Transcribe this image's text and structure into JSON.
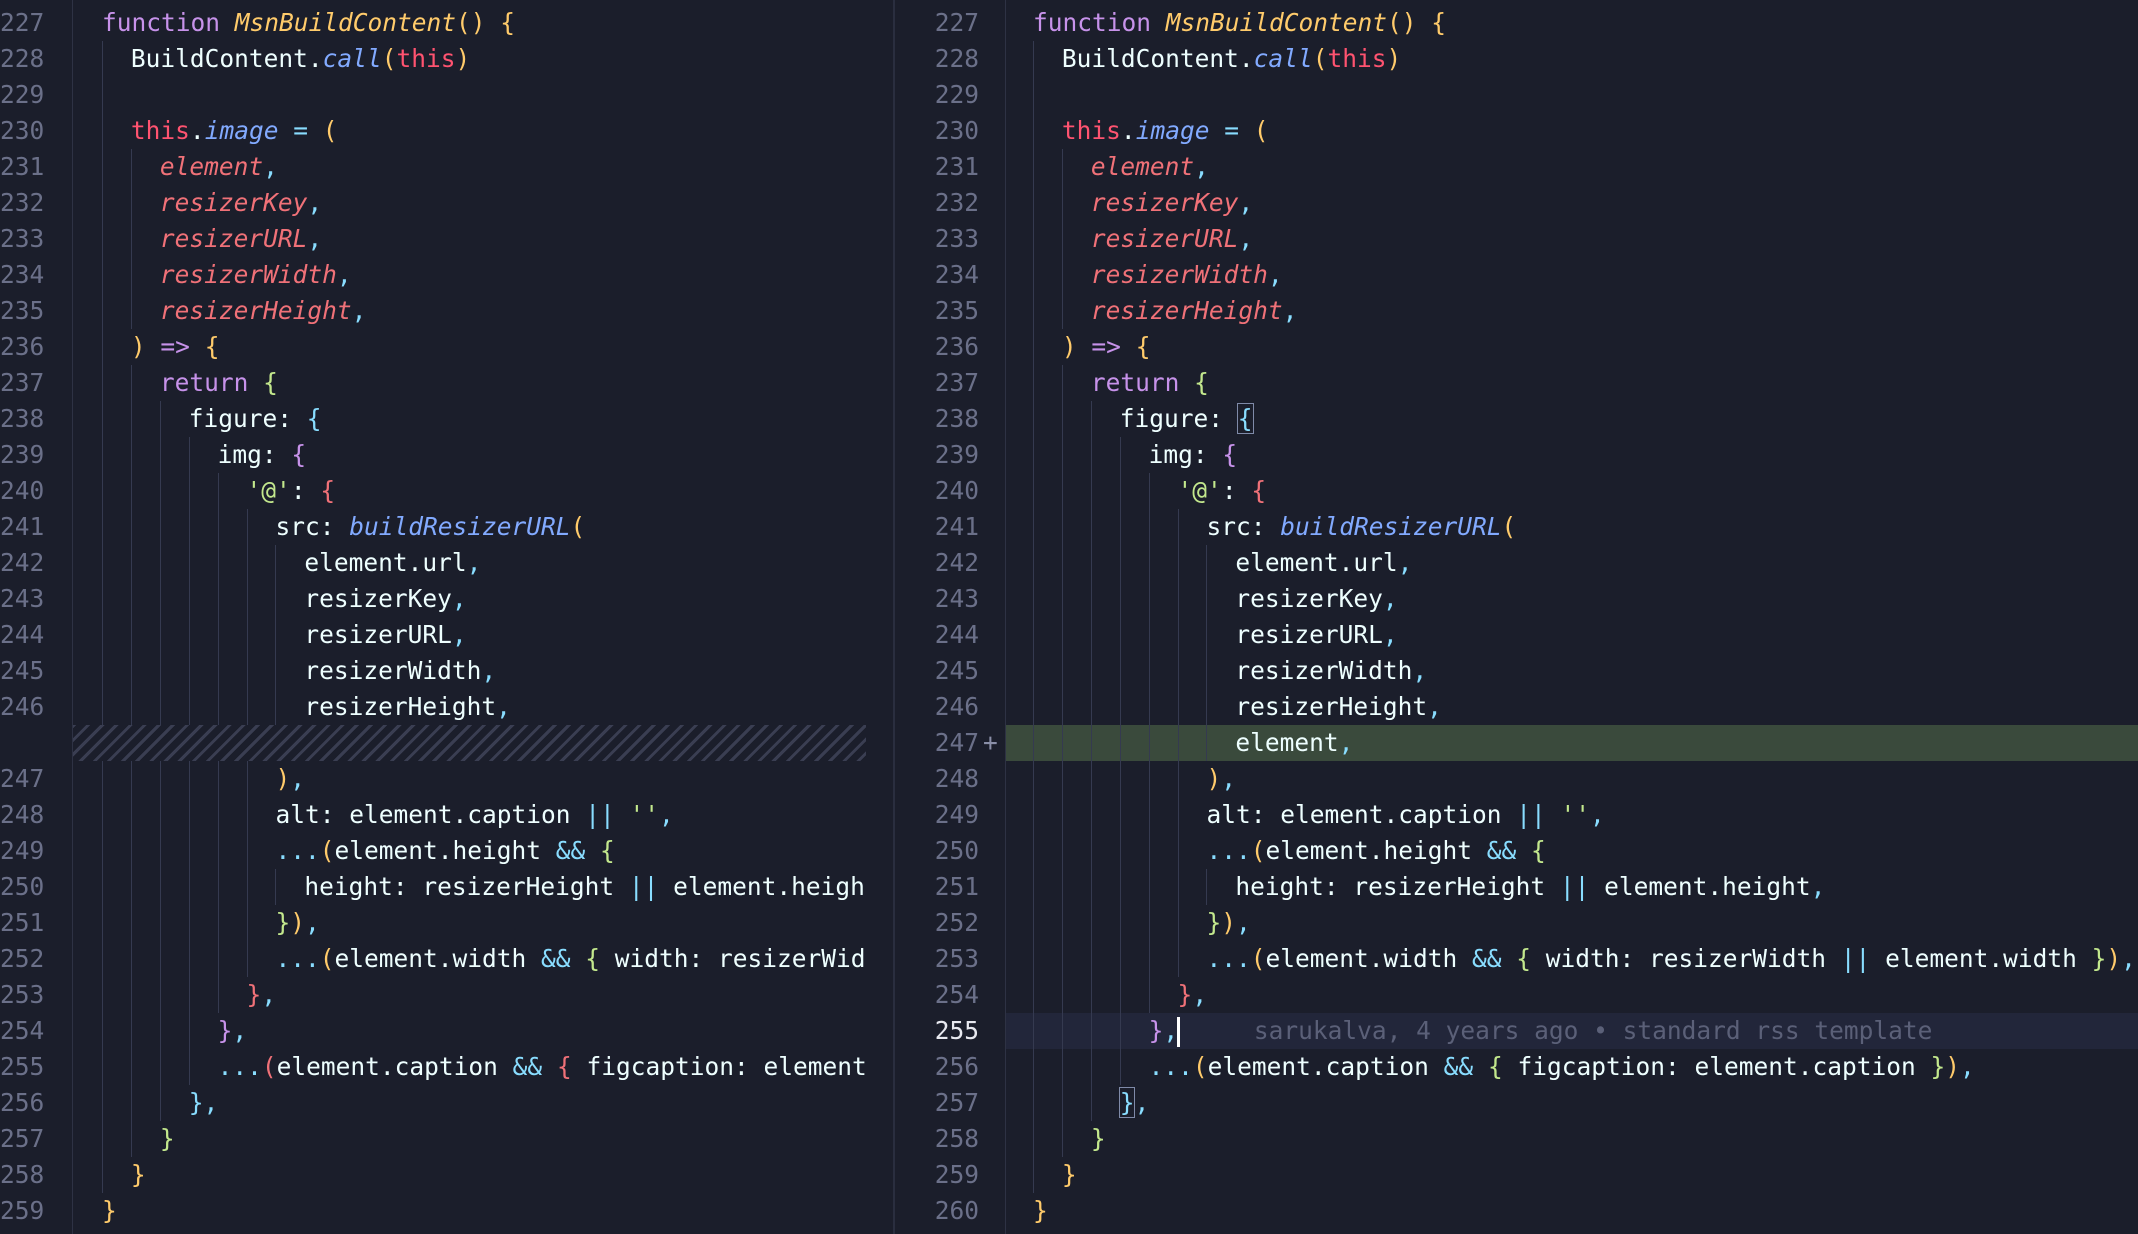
{
  "left": {
    "lines": [
      {
        "n": "227",
        "indent": 0,
        "tokens": [
          [
            "kw",
            "function "
          ],
          [
            "fnn",
            "MsnBuildContent"
          ],
          [
            "b1",
            "() {"
          ]
        ]
      },
      {
        "n": "228",
        "indent": 1,
        "tokens": [
          [
            "pl",
            "BuildContent."
          ],
          [
            "fn",
            "call"
          ],
          [
            "b1",
            "("
          ],
          [
            "tht",
            "this"
          ],
          [
            "b1",
            ")"
          ]
        ]
      },
      {
        "n": "229",
        "indent": 1,
        "tokens": []
      },
      {
        "n": "230",
        "indent": 1,
        "tokens": [
          [
            "tht",
            "this"
          ],
          [
            "pl",
            "."
          ],
          [
            "prop",
            "image"
          ],
          [
            "op",
            " = "
          ],
          [
            "b1",
            "("
          ]
        ]
      },
      {
        "n": "231",
        "indent": 2,
        "tokens": [
          [
            "param",
            "element"
          ],
          [
            "pu",
            ","
          ]
        ]
      },
      {
        "n": "232",
        "indent": 2,
        "tokens": [
          [
            "param",
            "resizerKey"
          ],
          [
            "pu",
            ","
          ]
        ]
      },
      {
        "n": "233",
        "indent": 2,
        "tokens": [
          [
            "param",
            "resizerURL"
          ],
          [
            "pu",
            ","
          ]
        ]
      },
      {
        "n": "234",
        "indent": 2,
        "tokens": [
          [
            "param",
            "resizerWidth"
          ],
          [
            "pu",
            ","
          ]
        ]
      },
      {
        "n": "235",
        "indent": 2,
        "tokens": [
          [
            "param",
            "resizerHeight"
          ],
          [
            "pu",
            ","
          ]
        ]
      },
      {
        "n": "236",
        "indent": 1,
        "tokens": [
          [
            "b1",
            ")"
          ],
          [
            "kw",
            " => "
          ],
          [
            "b1",
            "{"
          ]
        ]
      },
      {
        "n": "237",
        "indent": 2,
        "tokens": [
          [
            "kw",
            "return "
          ],
          [
            "b2",
            "{"
          ]
        ]
      },
      {
        "n": "238",
        "indent": 3,
        "tokens": [
          [
            "pl",
            "figure: "
          ],
          [
            "b3",
            "{"
          ]
        ]
      },
      {
        "n": "239",
        "indent": 4,
        "tokens": [
          [
            "pl",
            "img: "
          ],
          [
            "b4",
            "{"
          ]
        ]
      },
      {
        "n": "240",
        "indent": 5,
        "tokens": [
          [
            "str",
            "'@'"
          ],
          [
            "pl",
            ": "
          ],
          [
            "b5",
            "{"
          ]
        ]
      },
      {
        "n": "241",
        "indent": 6,
        "tokens": [
          [
            "pl",
            "src: "
          ],
          [
            "fn",
            "buildResizerURL"
          ],
          [
            "b1",
            "("
          ]
        ]
      },
      {
        "n": "242",
        "indent": 7,
        "tokens": [
          [
            "pl",
            "element.url"
          ],
          [
            "pu",
            ","
          ]
        ]
      },
      {
        "n": "243",
        "indent": 7,
        "tokens": [
          [
            "pl",
            "resizerKey"
          ],
          [
            "pu",
            ","
          ]
        ]
      },
      {
        "n": "244",
        "indent": 7,
        "tokens": [
          [
            "pl",
            "resizerURL"
          ],
          [
            "pu",
            ","
          ]
        ]
      },
      {
        "n": "245",
        "indent": 7,
        "tokens": [
          [
            "pl",
            "resizerWidth"
          ],
          [
            "pu",
            ","
          ]
        ]
      },
      {
        "n": "246",
        "indent": 7,
        "tokens": [
          [
            "pl",
            "resizerHeight"
          ],
          [
            "pu",
            ","
          ]
        ]
      },
      {
        "n": "",
        "indent": 0,
        "filler": true,
        "tokens": []
      },
      {
        "n": "247",
        "indent": 6,
        "tokens": [
          [
            "b1",
            ")"
          ],
          [
            "pu",
            ","
          ]
        ]
      },
      {
        "n": "248",
        "indent": 6,
        "tokens": [
          [
            "pl",
            "alt: element.caption "
          ],
          [
            "op",
            "|| "
          ],
          [
            "str",
            "''"
          ],
          [
            "pu",
            ","
          ]
        ]
      },
      {
        "n": "249",
        "indent": 6,
        "tokens": [
          [
            "op",
            "..."
          ],
          [
            "b1",
            "("
          ],
          [
            "pl",
            "element.height "
          ],
          [
            "op",
            "&& "
          ],
          [
            "b2",
            "{"
          ]
        ]
      },
      {
        "n": "250",
        "indent": 7,
        "tokens": [
          [
            "pl",
            "height: resizerHeight "
          ],
          [
            "op",
            "|| "
          ],
          [
            "pl",
            "element.height"
          ]
        ]
      },
      {
        "n": "251",
        "indent": 6,
        "tokens": [
          [
            "b2",
            "}"
          ],
          [
            "b1",
            ")"
          ],
          [
            "pu",
            ","
          ]
        ]
      },
      {
        "n": "252",
        "indent": 6,
        "tokens": [
          [
            "op",
            "..."
          ],
          [
            "b1",
            "("
          ],
          [
            "pl",
            "element.width "
          ],
          [
            "op",
            "&& "
          ],
          [
            "b2",
            "{ "
          ],
          [
            "pl",
            "width: resizerWidt"
          ]
        ]
      },
      {
        "n": "253",
        "indent": 5,
        "tokens": [
          [
            "b5",
            "}"
          ],
          [
            "pu",
            ","
          ]
        ]
      },
      {
        "n": "254",
        "indent": 4,
        "tokens": [
          [
            "b4",
            "}"
          ],
          [
            "pu",
            ","
          ]
        ]
      },
      {
        "n": "255",
        "indent": 4,
        "tokens": [
          [
            "op",
            "..."
          ],
          [
            "b5",
            "("
          ],
          [
            "pl",
            "element.caption "
          ],
          [
            "op",
            "&& "
          ],
          [
            "b5",
            "{ "
          ],
          [
            "pl",
            "figcaption: element."
          ]
        ]
      },
      {
        "n": "256",
        "indent": 3,
        "tokens": [
          [
            "b3",
            "}"
          ],
          [
            "pu",
            ","
          ]
        ]
      },
      {
        "n": "257",
        "indent": 2,
        "tokens": [
          [
            "b2",
            "}"
          ]
        ]
      },
      {
        "n": "258",
        "indent": 1,
        "tokens": [
          [
            "b1",
            "}"
          ]
        ]
      },
      {
        "n": "259",
        "indent": 0,
        "tokens": [
          [
            "b1",
            "}"
          ]
        ]
      }
    ]
  },
  "right": {
    "blame": "sarukalva, 4 years ago • standard rss template",
    "added_marker": "+",
    "lines": [
      {
        "n": "227",
        "indent": 0,
        "tokens": [
          [
            "kw",
            "function "
          ],
          [
            "fnn",
            "MsnBuildContent"
          ],
          [
            "b1",
            "() {"
          ]
        ]
      },
      {
        "n": "228",
        "indent": 1,
        "tokens": [
          [
            "pl",
            "BuildContent."
          ],
          [
            "fn",
            "call"
          ],
          [
            "b1",
            "("
          ],
          [
            "tht",
            "this"
          ],
          [
            "b1",
            ")"
          ]
        ]
      },
      {
        "n": "229",
        "indent": 1,
        "tokens": []
      },
      {
        "n": "230",
        "indent": 1,
        "tokens": [
          [
            "tht",
            "this"
          ],
          [
            "pl",
            "."
          ],
          [
            "prop",
            "image"
          ],
          [
            "op",
            " = "
          ],
          [
            "b1",
            "("
          ]
        ]
      },
      {
        "n": "231",
        "indent": 2,
        "tokens": [
          [
            "param",
            "element"
          ],
          [
            "pu",
            ","
          ]
        ]
      },
      {
        "n": "232",
        "indent": 2,
        "tokens": [
          [
            "param",
            "resizerKey"
          ],
          [
            "pu",
            ","
          ]
        ]
      },
      {
        "n": "233",
        "indent": 2,
        "tokens": [
          [
            "param",
            "resizerURL"
          ],
          [
            "pu",
            ","
          ]
        ]
      },
      {
        "n": "234",
        "indent": 2,
        "tokens": [
          [
            "param",
            "resizerWidth"
          ],
          [
            "pu",
            ","
          ]
        ]
      },
      {
        "n": "235",
        "indent": 2,
        "tokens": [
          [
            "param",
            "resizerHeight"
          ],
          [
            "pu",
            ","
          ]
        ]
      },
      {
        "n": "236",
        "indent": 1,
        "tokens": [
          [
            "b1",
            ")"
          ],
          [
            "kw",
            " => "
          ],
          [
            "b1",
            "{"
          ]
        ]
      },
      {
        "n": "237",
        "indent": 2,
        "tokens": [
          [
            "kw",
            "return "
          ],
          [
            "b2",
            "{"
          ]
        ]
      },
      {
        "n": "238",
        "indent": 3,
        "tokens": [
          [
            "pl",
            "figure: "
          ],
          [
            "b3 bracket-box",
            "{"
          ]
        ]
      },
      {
        "n": "239",
        "indent": 4,
        "tokens": [
          [
            "pl",
            "img: "
          ],
          [
            "b4",
            "{"
          ]
        ]
      },
      {
        "n": "240",
        "indent": 5,
        "tokens": [
          [
            "str",
            "'@'"
          ],
          [
            "pl",
            ": "
          ],
          [
            "b5",
            "{"
          ]
        ]
      },
      {
        "n": "241",
        "indent": 6,
        "tokens": [
          [
            "pl",
            "src: "
          ],
          [
            "fn",
            "buildResizerURL"
          ],
          [
            "b1",
            "("
          ]
        ]
      },
      {
        "n": "242",
        "indent": 7,
        "tokens": [
          [
            "pl",
            "element.url"
          ],
          [
            "pu",
            ","
          ]
        ]
      },
      {
        "n": "243",
        "indent": 7,
        "tokens": [
          [
            "pl",
            "resizerKey"
          ],
          [
            "pu",
            ","
          ]
        ]
      },
      {
        "n": "244",
        "indent": 7,
        "tokens": [
          [
            "pl",
            "resizerURL"
          ],
          [
            "pu",
            ","
          ]
        ]
      },
      {
        "n": "245",
        "indent": 7,
        "tokens": [
          [
            "pl",
            "resizerWidth"
          ],
          [
            "pu",
            ","
          ]
        ]
      },
      {
        "n": "246",
        "indent": 7,
        "tokens": [
          [
            "pl",
            "resizerHeight"
          ],
          [
            "pu",
            ","
          ]
        ]
      },
      {
        "n": "247",
        "indent": 7,
        "added": true,
        "tokens": [
          [
            "pl",
            "element"
          ],
          [
            "pu",
            ","
          ]
        ]
      },
      {
        "n": "248",
        "indent": 6,
        "tokens": [
          [
            "b1",
            ")"
          ],
          [
            "pu",
            ","
          ]
        ]
      },
      {
        "n": "249",
        "indent": 6,
        "tokens": [
          [
            "pl",
            "alt: element.caption "
          ],
          [
            "op",
            "|| "
          ],
          [
            "str",
            "''"
          ],
          [
            "pu",
            ","
          ]
        ]
      },
      {
        "n": "250",
        "indent": 6,
        "tokens": [
          [
            "op",
            "..."
          ],
          [
            "b1",
            "("
          ],
          [
            "pl",
            "element.height "
          ],
          [
            "op",
            "&& "
          ],
          [
            "b2",
            "{"
          ]
        ]
      },
      {
        "n": "251",
        "indent": 7,
        "tokens": [
          [
            "pl",
            "height: resizerHeight "
          ],
          [
            "op",
            "|| "
          ],
          [
            "pl",
            "element.height"
          ],
          [
            "pu",
            ","
          ]
        ]
      },
      {
        "n": "252",
        "indent": 6,
        "tokens": [
          [
            "b2",
            "}"
          ],
          [
            "b1",
            ")"
          ],
          [
            "pu",
            ","
          ]
        ]
      },
      {
        "n": "253",
        "indent": 6,
        "tokens": [
          [
            "op",
            "..."
          ],
          [
            "b1",
            "("
          ],
          [
            "pl",
            "element.width "
          ],
          [
            "op",
            "&& "
          ],
          [
            "b2",
            "{ "
          ],
          [
            "pl",
            "width: resizerWidth "
          ],
          [
            "op",
            "|| "
          ],
          [
            "pl",
            "element.width "
          ],
          [
            "b2",
            "}"
          ],
          [
            "b1",
            ")"
          ],
          [
            "pu",
            ","
          ]
        ]
      },
      {
        "n": "254",
        "indent": 5,
        "tokens": [
          [
            "b5",
            "}"
          ],
          [
            "pu",
            ","
          ]
        ]
      },
      {
        "n": "255",
        "indent": 4,
        "current": true,
        "tokens": [
          [
            "b4",
            "}"
          ],
          [
            "pu",
            ","
          ]
        ]
      },
      {
        "n": "256",
        "indent": 4,
        "tokens": [
          [
            "op",
            "..."
          ],
          [
            "b1",
            "("
          ],
          [
            "pl",
            "element.caption "
          ],
          [
            "op",
            "&& "
          ],
          [
            "b2",
            "{ "
          ],
          [
            "pl",
            "figcaption: element.caption "
          ],
          [
            "b2",
            "}"
          ],
          [
            "b1",
            ")"
          ],
          [
            "pu",
            ","
          ]
        ]
      },
      {
        "n": "257",
        "indent": 3,
        "tokens": [
          [
            "b3 bracket-box",
            "}"
          ],
          [
            "pu",
            ","
          ]
        ]
      },
      {
        "n": "258",
        "indent": 2,
        "tokens": [
          [
            "b2",
            "}"
          ]
        ]
      },
      {
        "n": "259",
        "indent": 1,
        "tokens": [
          [
            "b1",
            "}"
          ]
        ]
      },
      {
        "n": "260",
        "indent": 0,
        "tokens": [
          [
            "b1",
            "}"
          ]
        ]
      }
    ]
  }
}
